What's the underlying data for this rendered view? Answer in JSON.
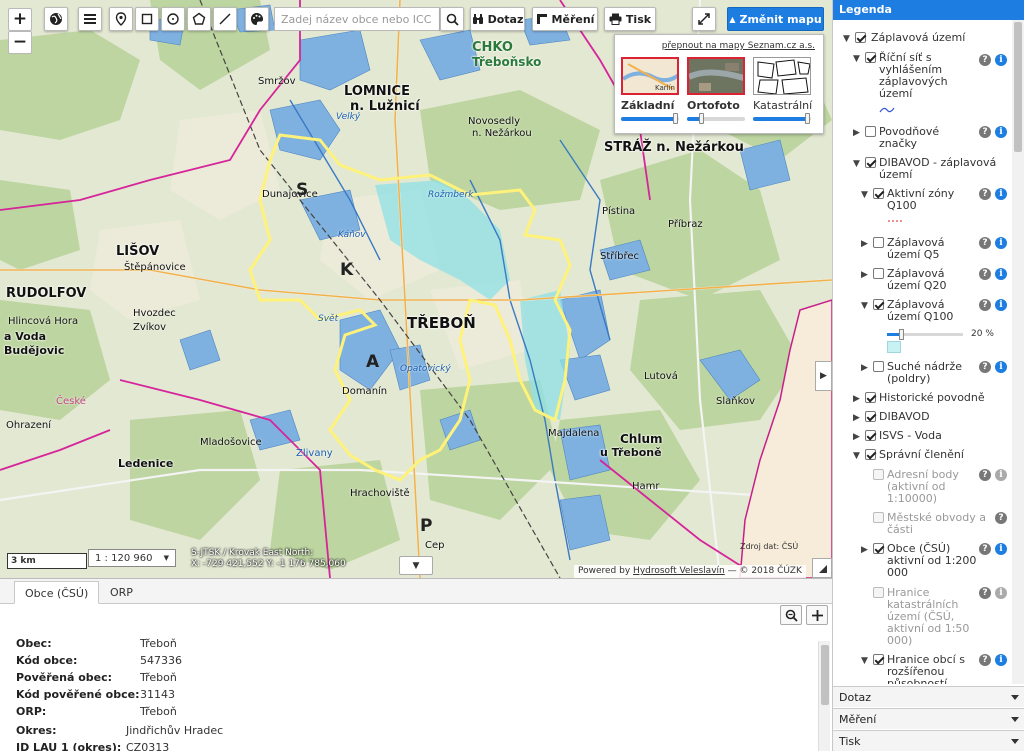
{
  "toolbar": {
    "zoom_in": "+",
    "zoom_out": "−",
    "search_placeholder": "Zadej název obce nebo ICC",
    "query_label": "Dotaz",
    "measure_label": "Měření",
    "print_label": "Tisk",
    "change_map_label": "Změnit mapu"
  },
  "map_switcher": {
    "link": "přepnout na mapy Seznam.cz a.s.",
    "maps": [
      {
        "name": "Základní",
        "level": 0.95,
        "thumb_label": "Karlín"
      },
      {
        "name": "Ortofoto",
        "level": 0.25
      },
      {
        "name": "Katastrální",
        "level": 0.95
      }
    ]
  },
  "map": {
    "scale_bar": "3 km",
    "scale_select": "1 : 120 960",
    "crs": "S-JTSK / Krovak East North:",
    "coords": "X: -729 421,552 Y: -1 176 785,060",
    "source_data": "Zdroj dat: ČSÚ",
    "attribution_prefix": "Powered by",
    "attribution_link": "Hydrosoft Veleslavín",
    "attribution_suffix": "— © 2018 ČÚZK",
    "labels": {
      "chko": "CHKO",
      "trebonsko": "Třeboňsko",
      "lomnice": "LOMNICE",
      "luznici": "n. Lužnicí",
      "smrzov": "Smržov",
      "novosedly": "Novosedly",
      "nezarkou": "n. Nežárkou",
      "straz": "STRÁŽ n. Nežárkou",
      "dunajovice": "Dunajovice",
      "lisov": "LIŠOV",
      "stepanovice": "Štěpánovice",
      "rudolfov": "RUDOLFOV",
      "hlinsko": "Hlincová Hora",
      "voda": "a Voda",
      "budejovic": "Budějovic",
      "trebon": "TŘEBOŇ",
      "domanin": "Domanín",
      "mladosovice": "Mladošovice",
      "ledenice": "Ledenice",
      "hrachoviste": "Hrachoviště",
      "chlum": "Chlum",
      "utrebone": "u Třeboně",
      "majdalena": "Majdalena",
      "pistina": "Pístina",
      "pribraz": "Příbraz",
      "stribrec": "Stříbřec",
      "slankov": "Slaňkov",
      "lutova": "Lutová",
      "hamr": "Hamr",
      "hvozdec": "Hvozdec",
      "zvikov": "Zvíkov",
      "ohrazeni": "Ohrazení",
      "cep": "Cep",
      "zlivany": "Zlivany",
      "veliky": "Velký",
      "kanov": "Káňov",
      "svet": "Svět",
      "opatovicky": "Opatovický",
      "rozmberk": "Rožmberk",
      "ceska": "České",
      "p1": "S",
      "p2": "K",
      "p3": "A",
      "p4": "P"
    }
  },
  "bottom": {
    "tabs": [
      "Obce (ČSÚ)",
      "ORP"
    ],
    "rows": [
      {
        "key": "Obec:",
        "value": "Třeboň"
      },
      {
        "key": "Kód obce:",
        "value": "547336"
      },
      {
        "key": "Pověřená obec:",
        "value": "Třeboň"
      },
      {
        "key": "Kód pověřené obce:",
        "value": "31143"
      },
      {
        "key": "ORP:",
        "value": "Třeboň"
      },
      {
        "key": "Okres:",
        "value": "Jindřichův Hradec"
      },
      {
        "key": "ID LAU 1 (okres):",
        "value": "CZ0313"
      }
    ]
  },
  "legend": {
    "title": "Legenda",
    "items": {
      "zaplavova_uzemi": "Záplavová území",
      "ricni_sit": "Říční síť s vyhlášením záplavových území",
      "povodnove_znacky": "Povodňové značky",
      "dibavod_zaplavova": "DIBAVOD - záplavová území",
      "aktivni_zony": "Aktivní zóny Q100",
      "q5": "Záplavová území Q5",
      "q20": "Záplavová území Q20",
      "q100": "Záplavová území Q100",
      "opacity": "20 %",
      "suche_nadrze": "Suché nádrže (poldry)",
      "historicke": "Historické povodně",
      "dibavod": "DIBAVOD",
      "isvs": "ISVS - Voda",
      "spravni": "Správní členění",
      "adresni": "Adresní body (aktivní od 1:10000)",
      "mestske": "Městské obvody a části",
      "obce": "Obce (ČSÚ) aktivní od 1:200 000",
      "hranice_kat": "Hranice katastrálních území (ČSÚ, aktivní od 1:50 000)",
      "hranice_obci": "Hranice obcí s rozšířenou působností"
    },
    "accordion": [
      "Dotaz",
      "Měření",
      "Tisk"
    ]
  },
  "colors": {
    "accent": "#1d7de0",
    "boundary": "#fff27a",
    "admin": "#d6249a"
  }
}
